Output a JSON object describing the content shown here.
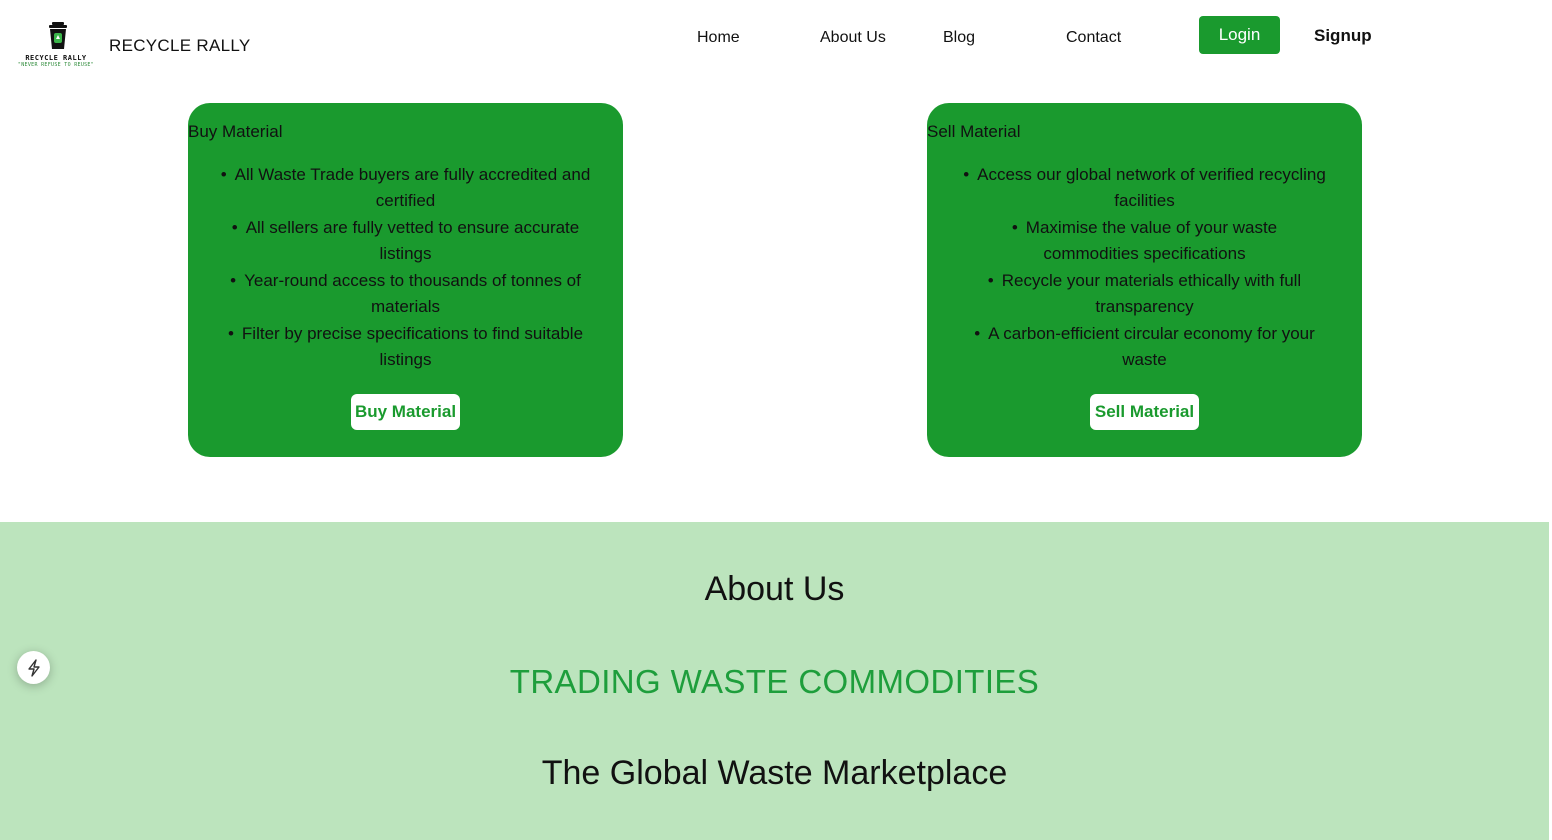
{
  "header": {
    "logo": {
      "name": "RECYCLE RALLY",
      "tagline": "\"NEVER REFUSE TO REUSE\""
    },
    "brand": "RECYCLE RALLY",
    "nav": [
      "Home",
      "About Us",
      "Blog",
      "Contact"
    ],
    "login_label": "Login",
    "signup_label": "Signup"
  },
  "cards": {
    "buy": {
      "title": "Buy Material",
      "items": [
        "All Waste Trade buyers are fully accredited and certified",
        "All sellers are fully vetted to ensure accurate listings",
        "Year-round access to thousands of tonnes of materials",
        "Filter by precise specifications to find suitable listings"
      ],
      "button": "Buy Material"
    },
    "sell": {
      "title": "Sell Material",
      "items": [
        "Access our global network of verified recycling facilities",
        "Maximise the value of your waste commodities specifications",
        "Recycle your materials ethically with full transparency",
        "A carbon-efficient circular economy for your waste"
      ],
      "button": "Sell Material"
    }
  },
  "about": {
    "heading": "About Us",
    "subheading": "TRADING WASTE COMMODITIES",
    "tagline": "The Global Waste Marketplace"
  },
  "colors": {
    "brand_green": "#1a9a2e",
    "section_bg": "#bce4bd",
    "accent_text": "#1e9e3c"
  },
  "icons": {
    "floating": "lightning-icon",
    "logo": "recycle-bin-icon"
  }
}
